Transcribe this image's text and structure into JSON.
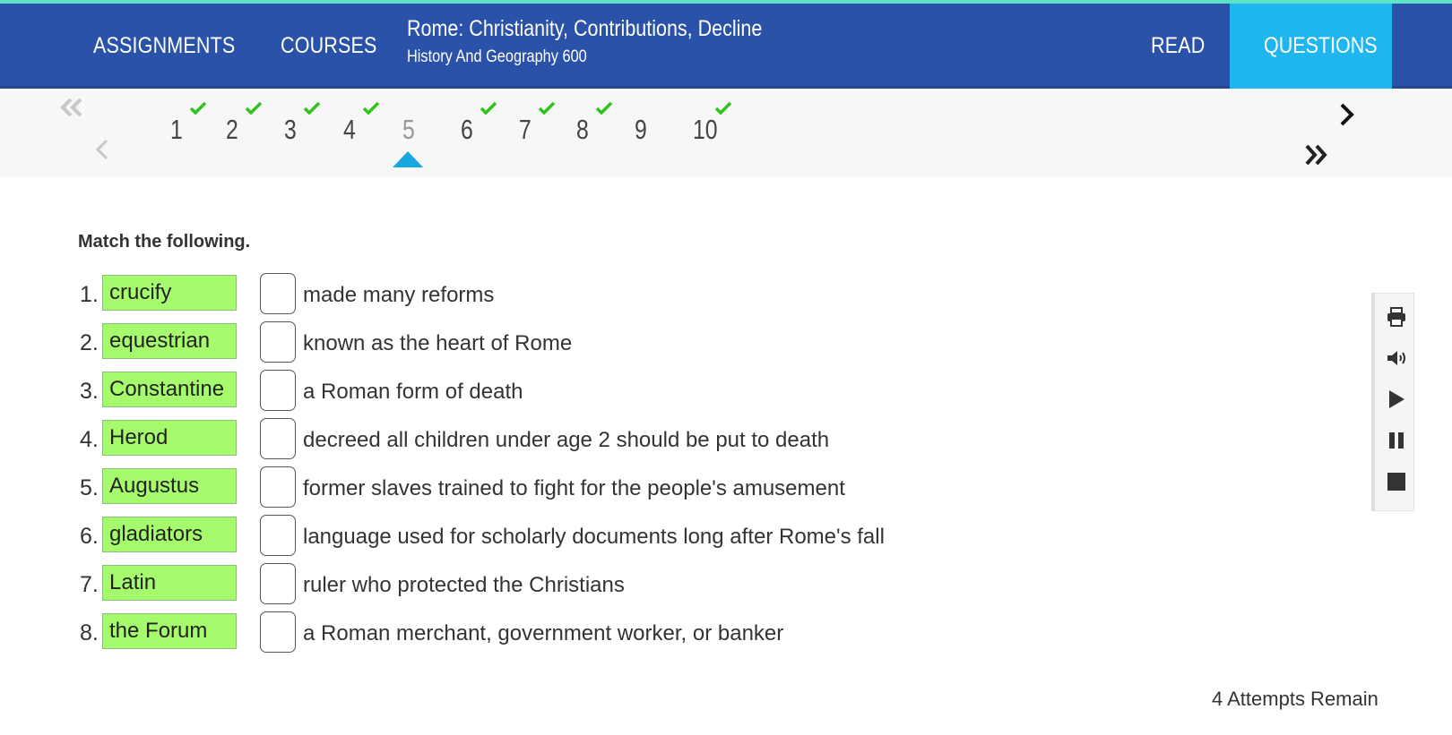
{
  "header": {
    "assignments_label": "ASSIGNMENTS",
    "courses_label": "COURSES",
    "title": "Rome: Christianity, Contributions, Decline",
    "subtitle": "History And Geography 600",
    "read_label": "READ",
    "questions_label": "QUESTIONS"
  },
  "question_nav": {
    "numbers": [
      "1",
      "2",
      "3",
      "4",
      "5",
      "6",
      "7",
      "8",
      "9",
      "10"
    ],
    "current": "5",
    "answered": [
      "1",
      "2",
      "3",
      "4",
      "6",
      "7",
      "8",
      "10"
    ],
    "icons": {
      "first": "double-chevron-left-icon",
      "prev": "chevron-left-icon",
      "next": "chevron-right-icon",
      "last": "double-chevron-right-icon"
    }
  },
  "question": {
    "instruction": "Match the following.",
    "rows": [
      {
        "num": "1.",
        "term": "crucify",
        "answer": "",
        "description": "made many reforms"
      },
      {
        "num": "2.",
        "term": "equestrian",
        "answer": "",
        "description": "known as the heart of Rome"
      },
      {
        "num": "3.",
        "term": "Constantine",
        "answer": "",
        "description": "a Roman form of death"
      },
      {
        "num": "4.",
        "term": "Herod",
        "answer": "",
        "description": "decreed all children under age 2 should be put to death"
      },
      {
        "num": "5.",
        "term": "Augustus",
        "answer": "",
        "description": "former slaves trained to fight for the people's amusement"
      },
      {
        "num": "6.",
        "term": "gladiators",
        "answer": "",
        "description": "language used for scholarly documents long after Rome's fall"
      },
      {
        "num": "7.",
        "term": "Latin",
        "answer": "",
        "description": "ruler who protected the Christians"
      },
      {
        "num": "8.",
        "term": "the Forum",
        "answer": "",
        "description": "a Roman merchant, government worker, or banker"
      }
    ]
  },
  "toolbar": {
    "icons": [
      "print-icon",
      "speaker-icon",
      "play-icon",
      "pause-icon",
      "stop-icon"
    ]
  },
  "status": {
    "attempts": "4 Attempts Remain"
  },
  "colors": {
    "header": "#2b52a9",
    "active_tab": "#1fb6f0",
    "stripe": "#5ee3c6",
    "term_bg": "#a6fb6d",
    "check": "#2fc41b",
    "caret": "#18a8e0"
  }
}
